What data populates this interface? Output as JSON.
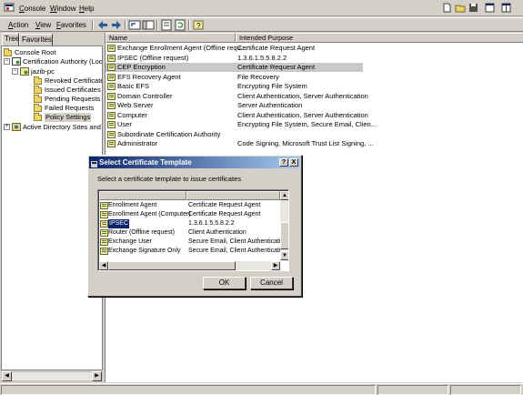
{
  "menu": {
    "items": [
      {
        "label": "Console",
        "key": "C",
        "rest": "onsole"
      },
      {
        "label": "Window",
        "key": "W",
        "rest": "indow"
      },
      {
        "label": "Help",
        "key": "H",
        "rest": "elp"
      }
    ]
  },
  "toolbar": {
    "action": {
      "key": "A",
      "rest": "ction"
    },
    "view": {
      "key": "V",
      "rest": "iew"
    },
    "favorites": {
      "key": "F",
      "rest": "avorites"
    }
  },
  "left": {
    "tabs": {
      "tree": "Tree",
      "favorites": "Favorites"
    },
    "tree": {
      "console_root": "Console Root",
      "ca": "Certification Authority (Local)",
      "server": "jazib-pc",
      "folders": [
        "Revoked Certificates",
        "Issued Certificates",
        "Pending Requests",
        "Failed Requests",
        "Policy Settings"
      ],
      "ad_sites": "Active Directory Sites and Ser"
    }
  },
  "list": {
    "columns": {
      "name": "Name",
      "purpose": "Intended Purpose"
    },
    "rows": [
      {
        "name": "Exchange Enrollment Agent (Offline requ...",
        "purpose": "Certificate Request Agent"
      },
      {
        "name": "IPSEC (Offline request)",
        "purpose": "1.3.6.1.5.5.8.2.2"
      },
      {
        "name": "CEP Encryption",
        "purpose": "Certificate Request Agent"
      },
      {
        "name": "EFS Recovery Agent",
        "purpose": "File Recovery"
      },
      {
        "name": "Basic EFS",
        "purpose": "Encrypting File System"
      },
      {
        "name": "Domain Controller",
        "purpose": "Client Authentication, Server Authentication"
      },
      {
        "name": "Web Server",
        "purpose": "Server Authentication"
      },
      {
        "name": "Computer",
        "purpose": "Client Authentication, Server Authentication"
      },
      {
        "name": "User",
        "purpose": "Encrypting File System, Secure Email, Clien..."
      },
      {
        "name": "Subordinate Certification Authority",
        "purpose": ""
      },
      {
        "name": "Administrator",
        "purpose": "Code Signing, Microsoft Trust List Signing, ..."
      }
    ]
  },
  "dialog": {
    "title": "Select Certificate Template",
    "help_glyph": "?",
    "close_glyph": "X",
    "prompt": "Select a certificate template to issue certificates",
    "rows": [
      {
        "name": "Enrollment Agent",
        "purpose": "Certificate Request Agent"
      },
      {
        "name": "Enrollment Agent (Computer)",
        "purpose": "Certificate Request Agent"
      },
      {
        "name": "IPSEC",
        "purpose": "1.3.6.1.5.5.8.2.2"
      },
      {
        "name": "Router (Offline request)",
        "purpose": "Client Authentication"
      },
      {
        "name": "Exchange User",
        "purpose": "Secure Email, Client Authenticatior"
      },
      {
        "name": "Exchange Signature Only",
        "purpose": "Secure Email, Client Authenticatior"
      }
    ],
    "ok_label": "OK",
    "cancel_label": "Cancel"
  }
}
